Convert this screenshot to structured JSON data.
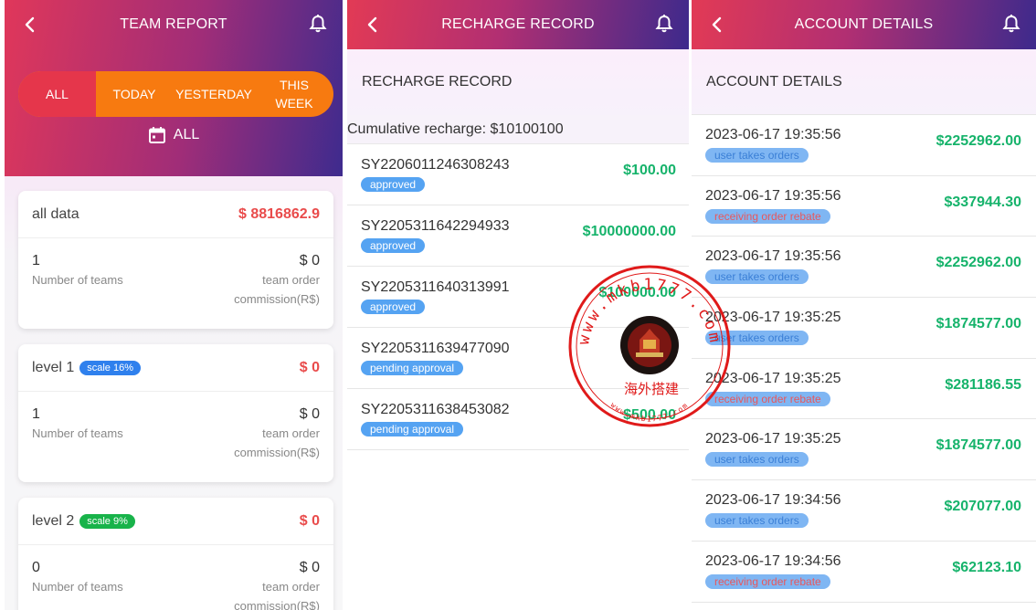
{
  "team": {
    "title": "TEAM REPORT",
    "tabs": [
      "ALL",
      "TODAY",
      "YESTERDAY",
      "THIS WEEK"
    ],
    "active_tab": "ALL",
    "date_filter": "ALL",
    "cards": [
      {
        "title": "all data",
        "amount": "$ 8816862.9",
        "count": "1",
        "count_label": "Number of teams",
        "value": "$ 0",
        "value_label_1": "team order",
        "value_label_2": "commission(R$)"
      },
      {
        "title": "level 1",
        "scale": "scale 16%",
        "amount": "$ 0",
        "count": "1",
        "count_label": "Number of teams",
        "value": "$ 0",
        "value_label_1": "team order",
        "value_label_2": "commission(R$)"
      },
      {
        "title": "level 2",
        "scale": "scale 9%",
        "amount": "$ 0",
        "count": "0",
        "count_label": "Number of teams",
        "value": "$ 0",
        "value_label_1": "team order",
        "value_label_2": "commission(R$)"
      }
    ]
  },
  "recharge": {
    "title": "RECHARGE RECORD",
    "subtitle": "RECHARGE RECORD",
    "cumulative": "Cumulative recharge: $10100100",
    "records": [
      {
        "id": "SY2206011246308243",
        "status": "approved",
        "amount": "$100.00"
      },
      {
        "id": "SY2205311642294933",
        "status": "approved",
        "amount": "$10000000.00"
      },
      {
        "id": "SY2205311640313991",
        "status": "approved",
        "amount": "$100000.00"
      },
      {
        "id": "SY2205311639477090",
        "status": "pending approval",
        "amount": ""
      },
      {
        "id": "SY2205311638453082",
        "status": "pending approval",
        "amount": "$500.00"
      }
    ]
  },
  "account": {
    "title": "ACCOUNT DETAILS",
    "subtitle": "ACCOUNT DETAILS",
    "entries": [
      {
        "time": "2023-06-17 19:35:56",
        "type": "user takes orders",
        "amount": "$2252962.00"
      },
      {
        "time": "2023-06-17 19:35:56",
        "type": "receiving order rebate",
        "amount": "$337944.30"
      },
      {
        "time": "2023-06-17 19:35:56",
        "type": "user takes orders",
        "amount": "$2252962.00"
      },
      {
        "time": "2023-06-17 19:35:25",
        "type": "user takes orders",
        "amount": "$1874577.00"
      },
      {
        "time": "2023-06-17 19:35:25",
        "type": "receiving order rebate",
        "amount": "$281186.55"
      },
      {
        "time": "2023-06-17 19:35:25",
        "type": "user takes orders",
        "amount": "$1874577.00"
      },
      {
        "time": "2023-06-17 19:34:56",
        "type": "user takes orders",
        "amount": "$207077.00"
      },
      {
        "time": "2023-06-17 19:34:56",
        "type": "receiving order rebate",
        "amount": "$62123.10"
      }
    ]
  },
  "watermark": {
    "text": "www.mkb1777.com",
    "cn_text": "海外搭建",
    "color": "#e01a1a"
  },
  "colors": {
    "accent_red": "#e94b4b",
    "green_amount": "#16b36b",
    "orange_tabs": "#f77a10"
  }
}
